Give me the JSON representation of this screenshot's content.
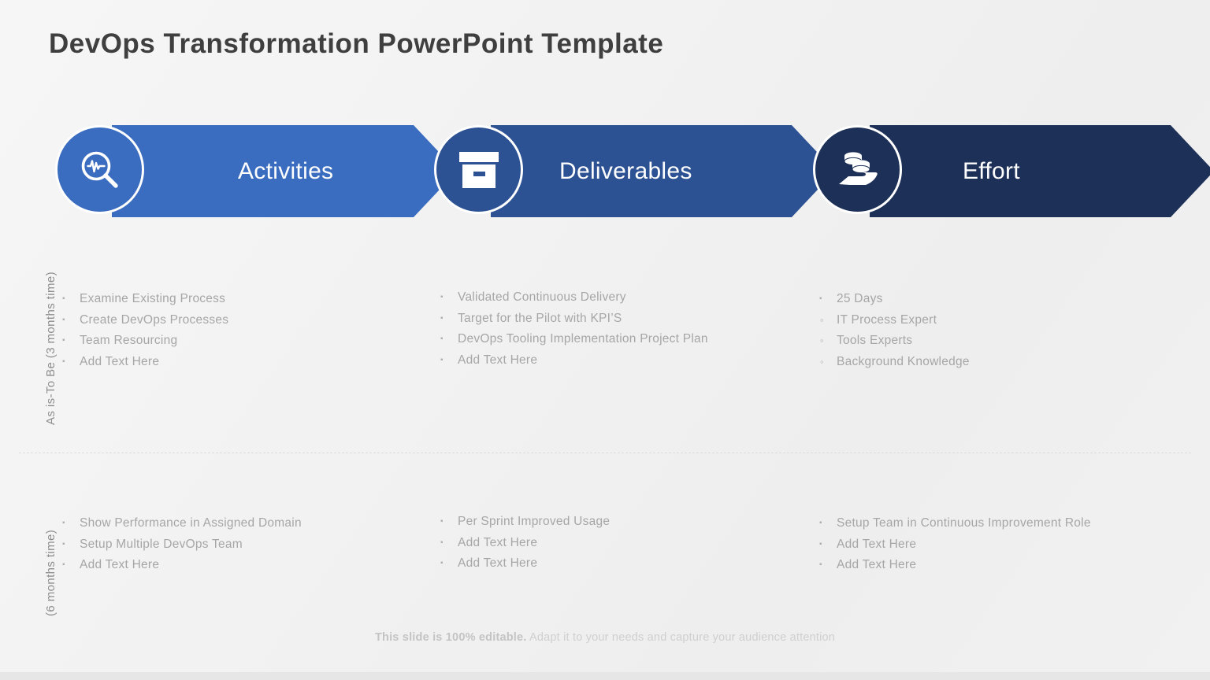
{
  "slide": {
    "title": "DevOps Transformation PowerPoint Template",
    "background_color": "#f1f1f1"
  },
  "banners": [
    {
      "label": "Activities",
      "icon": "magnifier-pulse-icon",
      "color": "#3a6cc0"
    },
    {
      "label": "Deliverables",
      "icon": "archive-box-icon",
      "color": "#2d5294"
    },
    {
      "label": "Effort",
      "icon": "hand-coins-icon",
      "color": "#1d3057"
    }
  ],
  "side_labels": {
    "top": "As is-To Be (3 months time)",
    "bottom": "(6 months time)"
  },
  "rows": [
    {
      "name": "as-is-to-be",
      "columns": [
        {
          "column": "activities",
          "items": [
            {
              "text": "Examine Existing Process",
              "bullet": "square"
            },
            {
              "text": "Create DevOps Processes",
              "bullet": "square"
            },
            {
              "text": "Team Resourcing",
              "bullet": "square"
            },
            {
              "text": "Add Text Here",
              "bullet": "square"
            }
          ]
        },
        {
          "column": "deliverables",
          "items": [
            {
              "text": "Validated Continuous Delivery",
              "bullet": "square"
            },
            {
              "text": "Target for the Pilot with KPI’S",
              "bullet": "square"
            },
            {
              "text": "DevOps Tooling Implementation Project Plan",
              "bullet": "square"
            },
            {
              "text": "Add Text Here",
              "bullet": "square"
            }
          ]
        },
        {
          "column": "effort",
          "items": [
            {
              "text": "25 Days",
              "bullet": "square"
            },
            {
              "text": "IT Process Expert",
              "bullet": "circle"
            },
            {
              "text": "Tools Experts",
              "bullet": "circle"
            },
            {
              "text": "Background Knowledge",
              "bullet": "circle"
            }
          ]
        }
      ]
    },
    {
      "name": "six-months",
      "columns": [
        {
          "column": "activities",
          "items": [
            {
              "text": "Show Performance in Assigned Domain",
              "bullet": "square"
            },
            {
              "text": "Setup Multiple DevOps Team",
              "bullet": "square"
            },
            {
              "text": "Add Text Here",
              "bullet": "square"
            }
          ]
        },
        {
          "column": "deliverables",
          "items": [
            {
              "text": "Per Sprint Improved Usage",
              "bullet": "square"
            },
            {
              "text": "Add Text Here",
              "bullet": "square"
            },
            {
              "text": "Add Text Here",
              "bullet": "square"
            }
          ]
        },
        {
          "column": "effort",
          "items": [
            {
              "text": "Setup Team in Continuous Improvement Role",
              "bullet": "square"
            },
            {
              "text": "Add Text Here",
              "bullet": "square"
            },
            {
              "text": "Add Text Here",
              "bullet": "square"
            }
          ]
        }
      ]
    }
  ],
  "footer": {
    "strong": "This slide is 100% editable.",
    "rest": " Adapt it to your needs and capture your audience attention"
  },
  "bullet_glyphs": {
    "square": "▪",
    "circle": "◦"
  }
}
